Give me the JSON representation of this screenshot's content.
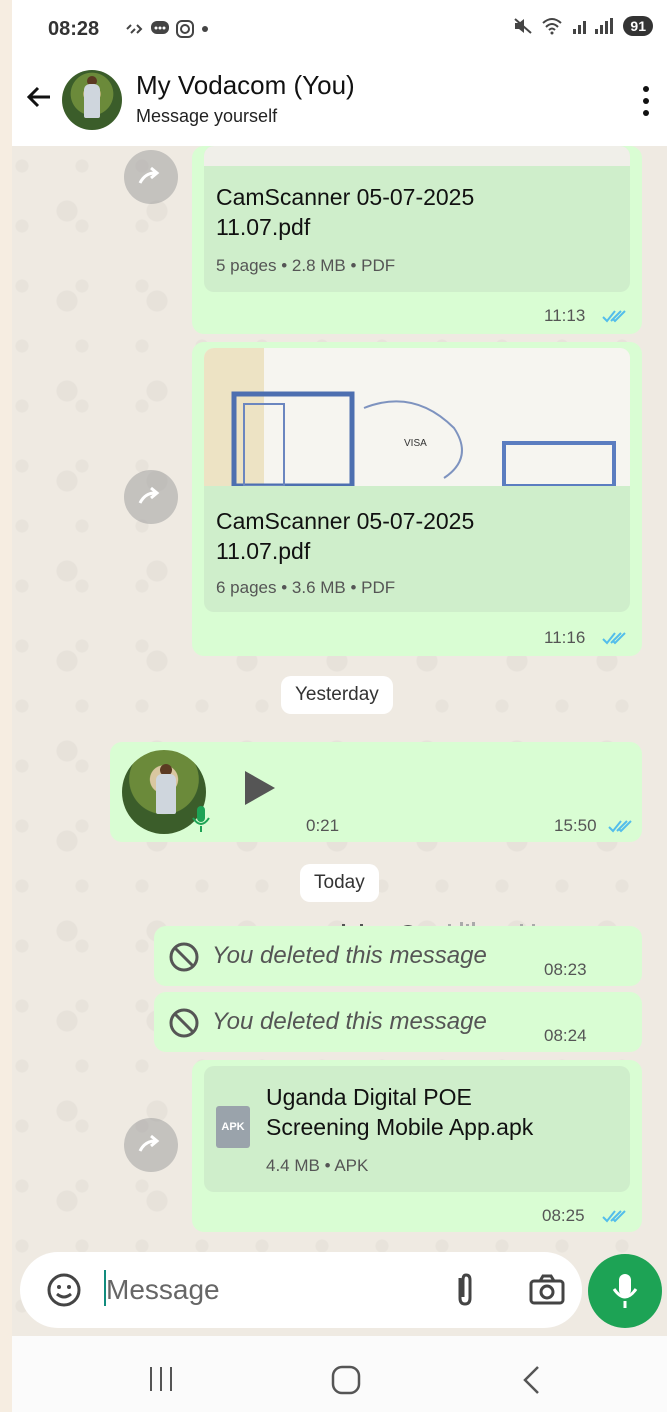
{
  "status_bar": {
    "time": "08:28",
    "battery": "91"
  },
  "header": {
    "title": "My Vodacom (You)",
    "subtitle": "Message yourself"
  },
  "messages": [
    {
      "title_line1": "CamScanner 05-07-2025",
      "title_line2": "11.07.pdf",
      "meta": "5 pages • 2.8 MB • PDF",
      "time": "11:13"
    },
    {
      "title_line1": "CamScanner 05-07-2025",
      "title_line2": "11.07.pdf",
      "meta": "6 pages • 3.6 MB • PDF",
      "time": "11:16"
    }
  ],
  "date_chips": {
    "yesterday": "Yesterday",
    "today": "Today"
  },
  "voice_note": {
    "duration": "0:21",
    "time": "15:50"
  },
  "deleted": [
    {
      "text": "You deleted this message",
      "time": "08:23"
    },
    {
      "text": "You deleted this message",
      "time": "08:24"
    }
  ],
  "apk": {
    "title_line1": "Uganda Digital POE",
    "title_line2": "Screening Mobile App.apk",
    "meta": "4.4 MB • APK",
    "icon_label": "APK",
    "time": "08:25"
  },
  "composer": {
    "placeholder": "Message"
  },
  "colors": {
    "bubble": "#d9fdd3",
    "accent": "#1da355",
    "tick": "#53bdeb"
  }
}
